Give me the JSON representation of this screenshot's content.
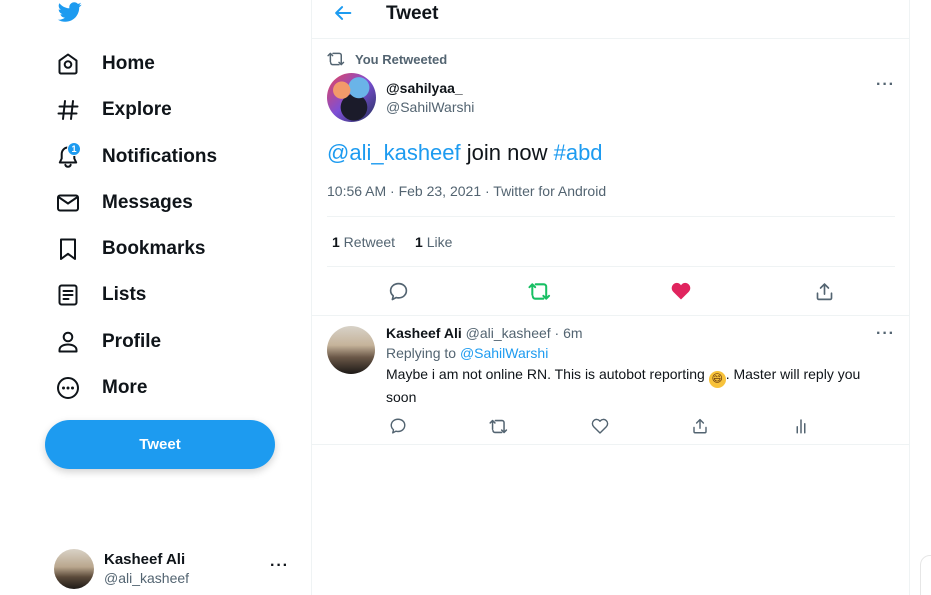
{
  "sidebar": {
    "logo_icon": "twitter-bird-icon",
    "brand_color": "#1d9bf0",
    "nav": {
      "home": "Home",
      "explore": "Explore",
      "notifications": "Notifications",
      "notifications_badge": "1",
      "messages": "Messages",
      "bookmarks": "Bookmarks",
      "lists": "Lists",
      "profile": "Profile",
      "more": "More"
    },
    "tweet_button": "Tweet",
    "account": {
      "name": "Kasheef Ali",
      "handle": "@ali_kasheef",
      "more": "···"
    }
  },
  "header": {
    "title": "Tweet",
    "back_icon": "arrow-left-icon"
  },
  "tweet": {
    "retweet_label": "You Retweeted",
    "author_name": "@sahilyaa_",
    "author_handle": "@SahilWarshi",
    "more": "···",
    "mention": "@ali_kasheef",
    "text_body": " join now ",
    "hashtag": "#abd",
    "meta": "10:56 AM · Feb 23, 2021 · Twitter for Android",
    "stats": {
      "retweets_count": "1",
      "retweets_label": " Retweet",
      "likes_count": "1",
      "likes_label": " Like"
    },
    "retweeted_color": "#17bf63",
    "liked_color": "#e0245e"
  },
  "reply": {
    "author_name": "Kasheef Ali",
    "author_handle_time": " @ali_kasheef · 6m",
    "replying_prefix": "Replying to ",
    "replying_to": "@SahilWarshi",
    "text_before_emoji": "Maybe i am not online RN. This is autobot reporting ",
    "emoji": "😄",
    "text_after_emoji": ". Master will reply you soon",
    "more": "···"
  }
}
